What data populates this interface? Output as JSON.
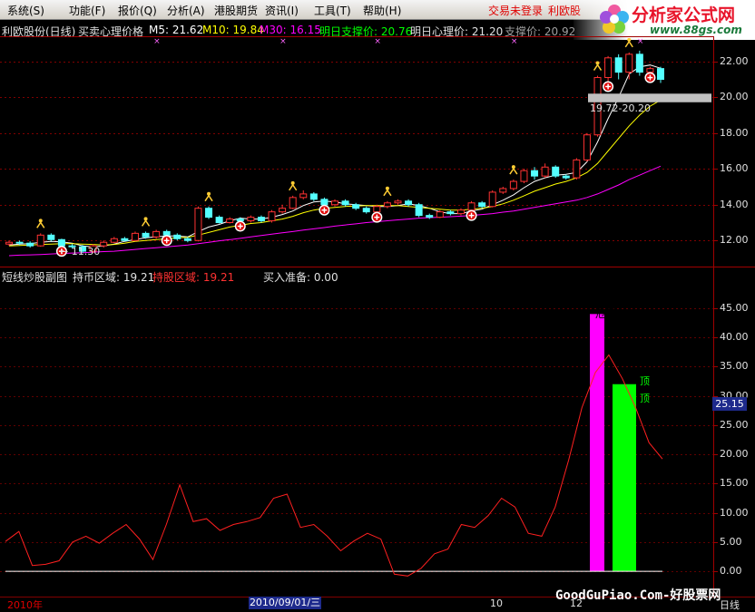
{
  "menu": [
    {
      "label": "系统(S)"
    },
    {
      "label": "功能(F)"
    },
    {
      "label": "报价(Q)"
    },
    {
      "label": "分析(A)"
    },
    {
      "label": "港股期货"
    },
    {
      "label": "资讯(I)"
    },
    {
      "label": "工具(T)"
    },
    {
      "label": "帮助(H)"
    }
  ],
  "status": {
    "login": "交易未登录",
    "stock": "利欧股"
  },
  "logo": {
    "text": "分析家公式网",
    "url": "www.88gs.com"
  },
  "main_info": {
    "title": "利欧股份(日线)",
    "indicator": "买卖心理价格",
    "m5": "M5: 21.62",
    "m10": "M10: 19.84",
    "m30": "M30: 16.15",
    "support": "明日支撑价: 20.76",
    "psych": "明日心理价: 21.20",
    "support2": "支撑价: 20.92"
  },
  "sub_info": {
    "title": "短线炒股副图",
    "hold_cash": "持币区域: 19.21",
    "hold_stock": "持股区域: 19.21",
    "buy_ready": "买入准备: 0.00"
  },
  "annotations": {
    "low": "← 11.30",
    "range": "19.72-20.20",
    "danger": "危险",
    "top1": "顶",
    "top2": "顶"
  },
  "current_value": "25.15",
  "bottom": {
    "year": "2010年",
    "date": "2010/09/01/三",
    "month10": "10",
    "month12": "12",
    "period": "日线",
    "watermark": "GoodGuPiao.Com-好股票网"
  },
  "colors": {
    "up": "#ff3232",
    "down": "#54ffff",
    "ma5": "#ffffff",
    "ma10": "#ffff00",
    "ma30": "#ff00ff",
    "danger_bar": "#ff00ff",
    "top_bar": "#00ff00"
  },
  "chart_data": [
    {
      "type": "candlestick",
      "title": "利欧股份(日线)",
      "ylim": [
        11,
        23
      ],
      "yticks": [
        12.0,
        14.0,
        16.0,
        18.0,
        20.0,
        22.0
      ],
      "candles": [
        [
          11.8,
          11.9,
          11.7,
          12.0
        ],
        [
          11.9,
          11.85,
          11.75,
          12.0
        ],
        [
          11.85,
          11.7,
          11.6,
          11.95
        ],
        [
          11.7,
          12.3,
          11.65,
          12.4
        ],
        [
          12.3,
          12.05,
          11.95,
          12.4
        ],
        [
          12.05,
          11.7,
          11.6,
          12.1
        ],
        [
          11.7,
          11.65,
          11.55,
          11.8
        ],
        [
          11.65,
          11.4,
          11.3,
          11.75
        ],
        [
          11.4,
          11.7,
          11.3,
          11.8
        ],
        [
          11.7,
          11.9,
          11.6,
          12.0
        ],
        [
          11.9,
          12.1,
          11.85,
          12.2
        ],
        [
          12.1,
          12.0,
          11.95,
          12.2
        ],
        [
          12.0,
          12.4,
          11.95,
          12.5
        ],
        [
          12.4,
          12.2,
          12.1,
          12.5
        ],
        [
          12.2,
          12.5,
          12.1,
          12.6
        ],
        [
          12.5,
          12.3,
          12.2,
          12.6
        ],
        [
          12.3,
          12.1,
          12.0,
          12.4
        ],
        [
          12.1,
          12.0,
          11.9,
          12.2
        ],
        [
          12.0,
          13.8,
          11.95,
          13.9
        ],
        [
          13.8,
          13.3,
          13.2,
          13.9
        ],
        [
          13.3,
          13.0,
          12.95,
          13.4
        ],
        [
          13.0,
          13.2,
          12.95,
          13.3
        ],
        [
          13.2,
          13.1,
          13.0,
          13.3
        ],
        [
          13.1,
          13.3,
          13.0,
          13.4
        ],
        [
          13.3,
          13.1,
          13.0,
          13.4
        ],
        [
          13.1,
          13.6,
          13.0,
          13.7
        ],
        [
          13.6,
          13.8,
          13.5,
          14.0
        ],
        [
          13.8,
          14.4,
          13.75,
          14.5
        ],
        [
          14.4,
          14.6,
          14.3,
          14.8
        ],
        [
          14.6,
          14.3,
          14.2,
          14.7
        ],
        [
          14.3,
          14.0,
          13.9,
          14.4
        ],
        [
          14.0,
          14.2,
          13.9,
          14.3
        ],
        [
          14.2,
          14.0,
          13.9,
          14.3
        ],
        [
          14.0,
          13.8,
          13.7,
          14.1
        ],
        [
          13.8,
          13.6,
          13.5,
          13.9
        ],
        [
          13.6,
          13.9,
          13.5,
          14.0
        ],
        [
          13.9,
          14.1,
          13.8,
          14.2
        ],
        [
          14.1,
          14.2,
          14.0,
          14.3
        ],
        [
          14.2,
          14.0,
          13.9,
          14.3
        ],
        [
          14.0,
          13.4,
          13.3,
          14.1
        ],
        [
          13.4,
          13.3,
          13.2,
          13.5
        ],
        [
          13.3,
          13.6,
          13.25,
          13.7
        ],
        [
          13.6,
          13.5,
          13.4,
          13.7
        ],
        [
          13.5,
          13.7,
          13.4,
          13.8
        ],
        [
          13.7,
          14.1,
          13.6,
          14.2
        ],
        [
          14.1,
          13.9,
          13.8,
          14.2
        ],
        [
          13.9,
          14.7,
          13.85,
          14.8
        ],
        [
          14.7,
          14.9,
          14.6,
          15.0
        ],
        [
          14.9,
          15.3,
          14.8,
          15.4
        ],
        [
          15.3,
          15.9,
          15.2,
          16.0
        ],
        [
          15.9,
          15.6,
          15.4,
          16.1
        ],
        [
          15.6,
          16.1,
          15.5,
          16.3
        ],
        [
          16.1,
          15.6,
          15.5,
          16.2
        ],
        [
          15.6,
          15.5,
          15.4,
          15.7
        ],
        [
          15.5,
          16.5,
          15.4,
          16.6
        ],
        [
          16.5,
          17.9,
          16.4,
          18.0
        ],
        [
          17.9,
          21.1,
          17.8,
          21.2
        ],
        [
          21.1,
          22.2,
          20.8,
          22.3
        ],
        [
          22.2,
          21.4,
          21.0,
          22.4
        ],
        [
          21.4,
          22.4,
          21.0,
          22.5
        ],
        [
          22.4,
          21.4,
          21.2,
          22.6
        ],
        [
          21.4,
          21.6,
          21.3,
          21.7
        ],
        [
          21.6,
          21.0,
          20.8,
          21.7
        ]
      ],
      "series": [
        {
          "name": "M5",
          "values": [
            11.75,
            11.8,
            11.82,
            11.9,
            11.95,
            11.92,
            11.85,
            11.7,
            11.65,
            11.7,
            11.8,
            11.95,
            12.05,
            12.15,
            12.2,
            12.25,
            12.25,
            12.2,
            12.5,
            12.75,
            12.9,
            13.1,
            13.25,
            13.2,
            13.2,
            13.3,
            13.45,
            13.65,
            13.95,
            14.15,
            14.2,
            14.15,
            14.05,
            14.0,
            13.95,
            13.9,
            13.9,
            13.95,
            14.05,
            13.95,
            13.8,
            13.6,
            13.5,
            13.5,
            13.65,
            13.75,
            14.0,
            14.25,
            14.55,
            14.95,
            15.3,
            15.5,
            15.65,
            15.7,
            15.8,
            16.4,
            17.5,
            18.8,
            20.0,
            21.3,
            21.7,
            21.8,
            21.62
          ]
        },
        {
          "name": "M10",
          "values": [
            11.7,
            11.72,
            11.75,
            11.78,
            11.8,
            11.82,
            11.82,
            11.8,
            11.78,
            11.75,
            11.78,
            11.85,
            11.95,
            12.0,
            12.05,
            12.1,
            12.15,
            12.18,
            12.3,
            12.45,
            12.6,
            12.75,
            12.85,
            12.95,
            13.0,
            13.1,
            13.2,
            13.35,
            13.55,
            13.7,
            13.8,
            13.85,
            13.9,
            13.92,
            13.95,
            13.95,
            13.95,
            13.95,
            13.9,
            13.85,
            13.8,
            13.75,
            13.7,
            13.7,
            13.75,
            13.8,
            13.9,
            14.05,
            14.25,
            14.5,
            14.75,
            14.95,
            15.15,
            15.3,
            15.5,
            15.8,
            16.3,
            17.0,
            17.7,
            18.4,
            19.0,
            19.5,
            19.84
          ]
        },
        {
          "name": "M30",
          "values": [
            11.15,
            11.18,
            11.2,
            11.22,
            11.25,
            11.28,
            11.3,
            11.32,
            11.35,
            11.38,
            11.4,
            11.45,
            11.5,
            11.55,
            11.6,
            11.65,
            11.7,
            11.75,
            11.82,
            11.9,
            11.98,
            12.05,
            12.12,
            12.2,
            12.28,
            12.35,
            12.43,
            12.5,
            12.58,
            12.65,
            12.72,
            12.8,
            12.87,
            12.93,
            13.0,
            13.05,
            13.1,
            13.15,
            13.2,
            13.25,
            13.28,
            13.3,
            13.33,
            13.36,
            13.4,
            13.45,
            13.5,
            13.58,
            13.65,
            13.75,
            13.85,
            13.95,
            14.05,
            14.15,
            14.25,
            14.4,
            14.6,
            14.85,
            15.1,
            15.4,
            15.65,
            15.9,
            16.15
          ]
        }
      ]
    },
    {
      "type": "line",
      "title": "短线炒股副图",
      "ylim": [
        -2,
        47
      ],
      "yticks": [
        0.0,
        5.0,
        10.0,
        15.0,
        20.0,
        25.0,
        30.0,
        35.0,
        40.0,
        45.0
      ],
      "series": [
        {
          "name": "持币区域",
          "values": [
            5.1,
            6.8,
            1.0,
            1.2,
            1.8,
            5.0,
            6.0,
            4.8,
            6.5,
            8.0,
            5.5,
            2.0,
            8.0,
            14.8,
            8.5,
            9.0,
            7.0,
            8.0,
            8.5,
            9.2,
            12.5,
            13.2,
            7.5,
            8.0,
            6.0,
            3.5,
            5.2,
            6.5,
            5.5,
            -0.5,
            -0.8,
            0.5,
            3.0,
            3.8,
            8.0,
            7.5,
            9.5,
            12.5,
            11.0,
            6.5,
            6.0,
            11.0,
            19.0,
            28.0,
            34.0,
            37.0,
            33.0,
            28.0,
            22.0,
            19.21
          ]
        },
        {
          "name": "买入准备",
          "values": [
            0,
            0,
            0,
            0,
            0,
            0,
            0,
            0,
            0,
            0,
            0,
            0,
            0,
            0,
            0,
            0,
            0,
            0,
            0,
            0,
            0,
            0,
            0,
            0,
            0,
            0,
            0,
            0,
            0,
            0,
            0,
            0,
            0,
            0,
            0,
            0,
            0,
            0,
            0,
            0,
            0,
            0,
            0,
            0,
            0,
            0,
            0,
            0,
            0,
            0
          ]
        }
      ],
      "bars": [
        {
          "name": "危险",
          "value": 44.0
        },
        {
          "name": "顶",
          "value": 32.0
        }
      ]
    }
  ]
}
